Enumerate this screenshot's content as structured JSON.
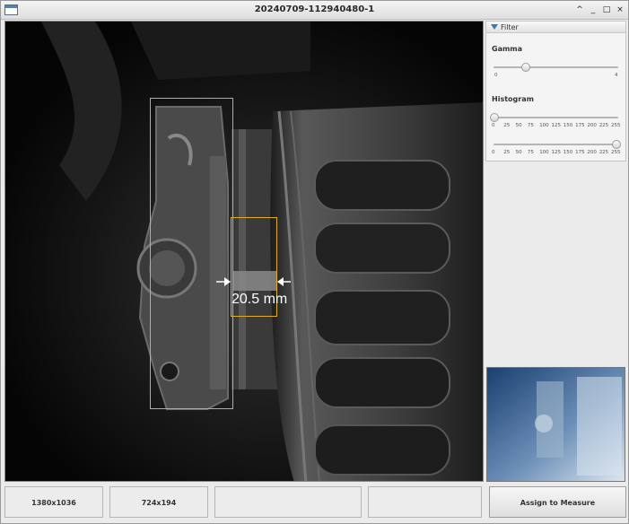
{
  "window": {
    "title": "20240709-112940480-1",
    "controls": [
      "^",
      "_",
      "□",
      "×"
    ]
  },
  "filter": {
    "header": "Filter",
    "gamma": {
      "label": "Gamma",
      "min": "0",
      "max": "4",
      "value": 1.0
    },
    "histogram": {
      "label": "Histogram",
      "ticks": [
        "0",
        "25",
        "50",
        "75",
        "100",
        "125",
        "150",
        "175",
        "200",
        "225",
        "255"
      ],
      "low": 0,
      "high": 255
    }
  },
  "measurement": {
    "label": "20.5 mm"
  },
  "status": {
    "resolution": "1380x1036",
    "roi_size": "724x194",
    "field3": "",
    "field4": ""
  },
  "actions": {
    "assign": "Assign to Measure"
  },
  "colors": {
    "roi": "#e0ad29",
    "accent": "#3a78c2"
  }
}
